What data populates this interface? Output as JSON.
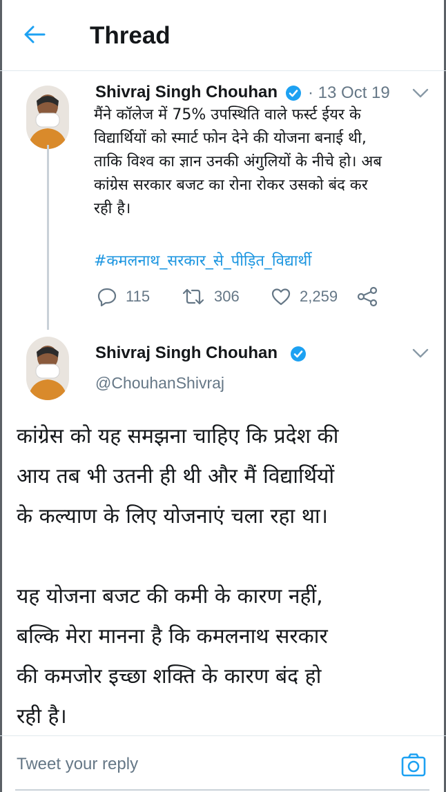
{
  "header": {
    "title": "Thread",
    "back_icon": "arrow-left-icon",
    "accent_color": "#1da1f2"
  },
  "tweet1": {
    "author": "Shivraj Singh Chouhan",
    "date": "· 13 Oct 19",
    "text_lines": [
      "मैंने कॉलेज में 75% उपस्थिति वाले फर्स्ट ईयर के",
      "विद्यार्थियों को स्मार्ट फोन देने की योजना बनाई थी,",
      "ताकि विश्व का ज्ञान उनकी अंगुलियों के नीचे हो। अब",
      "कांग्रेस सरकार बजट का रोना रोकर उसको बंद कर",
      "रही है।"
    ],
    "hashtag": "#कमलनाथ_सरकार_से_पीड़ित_विद्यार्थी",
    "replies": "115",
    "retweets": "306",
    "likes": "2,259"
  },
  "tweet2": {
    "author": "Shivraj Singh Chouhan",
    "handle": "@ChouhanShivraj",
    "text_lines": [
      "कांग्रेस को यह समझना चाहिए कि प्रदेश की",
      "आय तब भी उतनी ही थी और मैं विद्यार्थियों",
      "के कल्याण के लिए योजनाएं चला रहा था।",
      "",
      "यह योजना बजट की कमी के कारण नहीं,",
      "बल्कि मेरा मानना है कि कमलनाथ सरकार",
      "की कमजोर इच्छा शक्ति के कारण बंद हो",
      "रही है।"
    ]
  },
  "reply": {
    "placeholder": "Tweet your reply",
    "camera_icon": "camera-icon"
  }
}
